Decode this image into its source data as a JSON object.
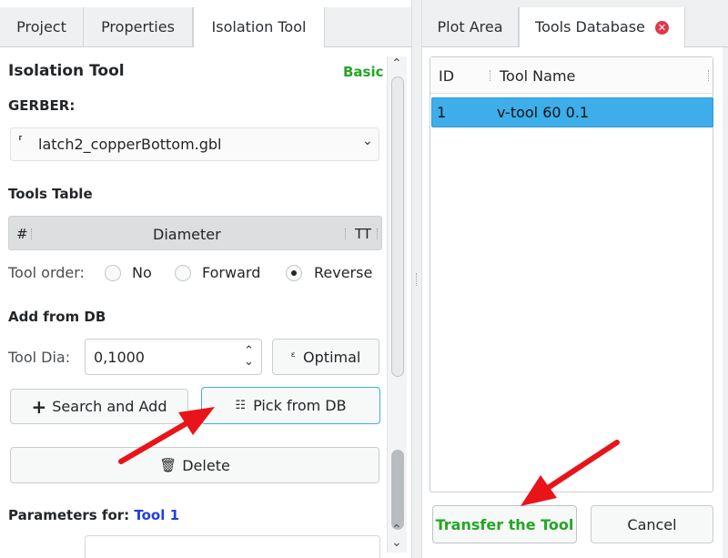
{
  "left_tabs": [
    {
      "label": "Project",
      "active": false
    },
    {
      "label": "Properties",
      "active": false
    },
    {
      "label": "Isolation Tool",
      "active": true
    }
  ],
  "isolation": {
    "title": "Isolation Tool",
    "mode": "Basic",
    "gerber_label": "GERBER:",
    "gerber_selected": "latch2_copperBottom.gbl",
    "tools_table_label": "Tools Table",
    "table_columns": [
      "#",
      "Diameter",
      "TT"
    ],
    "tool_order_label": "Tool order:",
    "tool_order_options": [
      "No",
      "Forward",
      "Reverse"
    ],
    "tool_order_selected": "Reverse",
    "add_from_db_label": "Add from DB",
    "tool_dia_label": "Tool Dia:",
    "tool_dia_value": "0,1000",
    "optimal_label": "Optimal",
    "search_add_label": "Search and Add",
    "pick_db_label": "Pick from DB",
    "delete_label": "Delete",
    "params_label": "Parameters for:",
    "params_tool": "Tool 1"
  },
  "right_tabs": [
    {
      "label": "Plot Area",
      "active": false
    },
    {
      "label": "Tools Database",
      "active": true
    }
  ],
  "tools_db": {
    "columns": [
      "ID",
      "Tool Name"
    ],
    "rows": [
      {
        "id": "1",
        "name": "v-tool 60 0.1"
      }
    ],
    "transfer_label": "Transfer the Tool",
    "cancel_label": "Cancel"
  },
  "colors": {
    "accent_green": "#24a624",
    "link_blue": "#1e3ee6",
    "selection": "#3daee9",
    "arrow_red": "#e8141a"
  }
}
